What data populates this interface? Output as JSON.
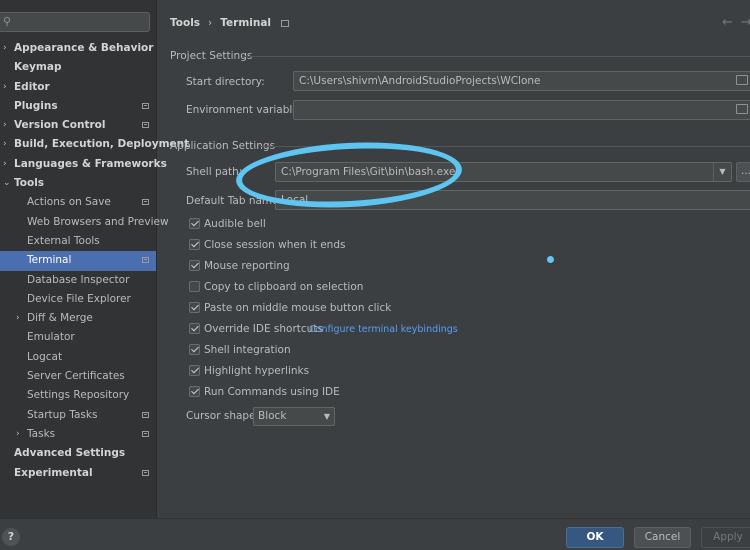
{
  "search": {
    "placeholder": ""
  },
  "sidebar": {
    "items": [
      {
        "label": "Appearance & Behavior",
        "arrow": "›"
      },
      {
        "label": "Keymap"
      },
      {
        "label": "Editor",
        "arrow": "›"
      },
      {
        "label": "Plugins"
      },
      {
        "label": "Version Control",
        "arrow": "›"
      },
      {
        "label": "Build, Execution, Deployment",
        "arrow": "›"
      },
      {
        "label": "Languages & Frameworks",
        "arrow": "›"
      },
      {
        "label": "Tools",
        "arrow": "⌄"
      },
      {
        "label": "Actions on Save"
      },
      {
        "label": "Web Browsers and Preview"
      },
      {
        "label": "External Tools"
      },
      {
        "label": "Terminal"
      },
      {
        "label": "Database Inspector"
      },
      {
        "label": "Device File Explorer"
      },
      {
        "label": "Diff & Merge",
        "arrow": "›"
      },
      {
        "label": "Emulator"
      },
      {
        "label": "Logcat"
      },
      {
        "label": "Server Certificates"
      },
      {
        "label": "Settings Repository"
      },
      {
        "label": "Startup Tasks"
      },
      {
        "label": "Tasks",
        "arrow": "›"
      },
      {
        "label": "Advanced Settings"
      },
      {
        "label": "Experimental"
      }
    ]
  },
  "breadcrumb": {
    "parent": "Tools",
    "current": "Terminal"
  },
  "project_settings": {
    "title": "Project Settings",
    "start_directory_label": "Start directory:",
    "start_directory_value": "C:\\Users\\shivm\\AndroidStudioProjects\\WClone",
    "env_label": "Environment variables:",
    "env_value": ""
  },
  "application_settings": {
    "title": "Application Settings",
    "shell_path_label": "Shell path:",
    "shell_path_value": "C:\\Program Files\\Git\\bin\\bash.exe",
    "shell_browse_label": "...",
    "default_tab_label": "Default Tab name:",
    "default_tab_value": "Local",
    "options": [
      {
        "label": "Audible bell",
        "checked": true
      },
      {
        "label": "Close session when it ends",
        "checked": true
      },
      {
        "label": "Mouse reporting",
        "checked": true
      },
      {
        "label": "Copy to clipboard on selection",
        "checked": false
      },
      {
        "label": "Paste on middle mouse button click",
        "checked": true
      },
      {
        "label": "Override IDE shortcuts",
        "checked": true
      },
      {
        "label": "Shell integration",
        "checked": true
      },
      {
        "label": "Highlight hyperlinks",
        "checked": true
      },
      {
        "label": "Run Commands using IDE",
        "checked": true
      }
    ],
    "configure_link": "Configure terminal keybindings",
    "cursor_shape_label": "Cursor shape:",
    "cursor_shape_value": "Block"
  },
  "buttons": {
    "ok": "OK",
    "cancel": "Cancel",
    "apply": "Apply",
    "help": "?"
  },
  "colors": {
    "background": "#3c3f41",
    "sidebar": "#313335",
    "selection": "#4b6eaf",
    "primary_button": "#365880",
    "link": "#589df6",
    "annotation": "#5ec4f0"
  }
}
